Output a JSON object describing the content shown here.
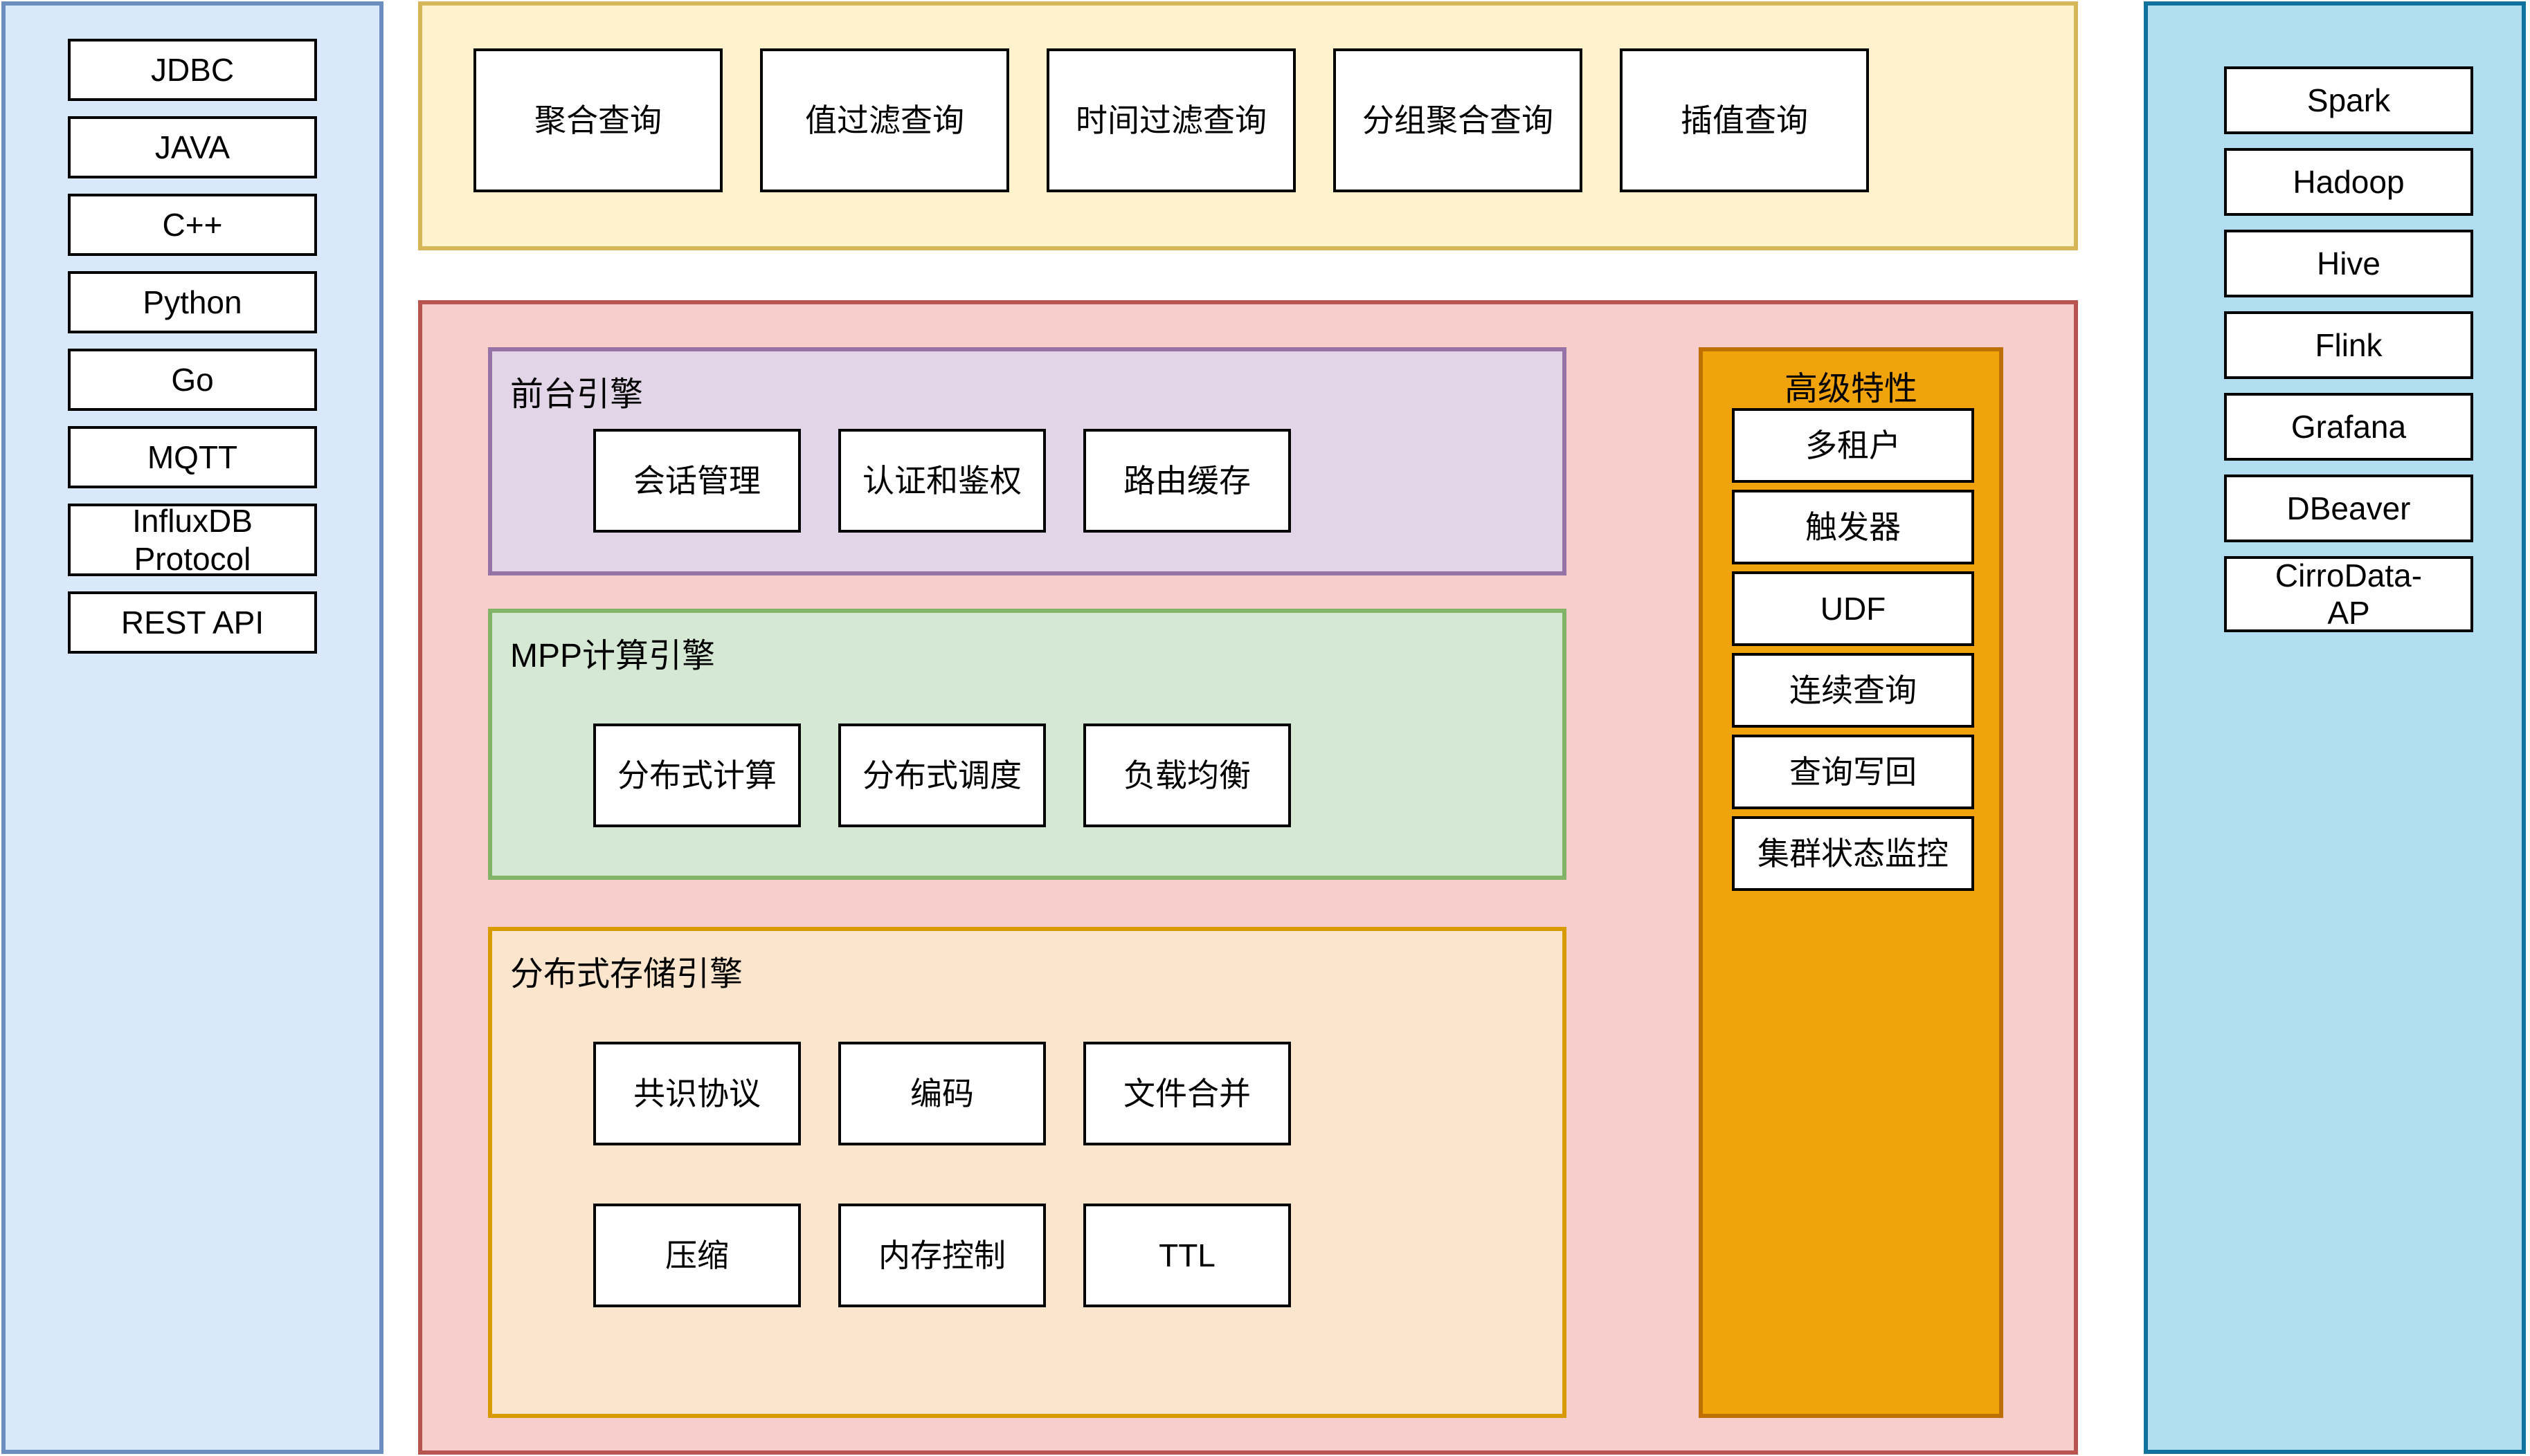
{
  "left_panel": {
    "name": "client-interfaces",
    "bg_color": "#dae8fc",
    "border_color": "#6c8ebf",
    "items": [
      {
        "label": "JDBC"
      },
      {
        "label": "JAVA"
      },
      {
        "label": "C++"
      },
      {
        "label": "Python"
      },
      {
        "label": "Go"
      },
      {
        "label": "MQTT"
      },
      {
        "label": "InfluxDB\nProtocol"
      },
      {
        "label": "REST API"
      }
    ]
  },
  "query_panel": {
    "name": "query-capabilities",
    "bg_color": "#fff2cc",
    "border_color": "#d6b656",
    "items": [
      {
        "label": "聚合查询"
      },
      {
        "label": "值过滤查询"
      },
      {
        "label": "时间过滤查询"
      },
      {
        "label": "分组聚合查询"
      },
      {
        "label": "插值查询"
      }
    ]
  },
  "engine_panel": {
    "name": "database-engine",
    "bg_color": "#f8cecc",
    "border_color": "#b85450",
    "frontend_engine": {
      "title": "前台引擎",
      "bg_color": "#e1d5e7",
      "border_color": "#9673a6",
      "items": [
        {
          "label": "会话管理"
        },
        {
          "label": "认证和鉴权"
        },
        {
          "label": "路由缓存"
        }
      ]
    },
    "mpp_engine": {
      "title": "MPP计算引擎",
      "bg_color": "#d5e8d4",
      "border_color": "#82b366",
      "items": [
        {
          "label": "分布式计算"
        },
        {
          "label": "分布式调度"
        },
        {
          "label": "负载均衡"
        }
      ]
    },
    "storage_engine": {
      "title": "分布式存储引擎",
      "bg_color": "#fce5cd",
      "border_color": "#d79b00",
      "row1": [
        {
          "label": "共识协议"
        },
        {
          "label": "编码"
        },
        {
          "label": "文件合并"
        }
      ],
      "row2": [
        {
          "label": "压缩"
        },
        {
          "label": "内存控制"
        },
        {
          "label": "TTL"
        }
      ]
    },
    "advanced_features": {
      "title": "高级特性",
      "bg_color": "#f0a30a",
      "border_color": "#bd7000",
      "items": [
        {
          "label": "多租户"
        },
        {
          "label": "触发器"
        },
        {
          "label": "UDF"
        },
        {
          "label": "连续查询"
        },
        {
          "label": "查询写回"
        },
        {
          "label": "集群状态监控"
        }
      ]
    }
  },
  "ecosystem_panel": {
    "name": "ecosystem-integrations",
    "bg_color": "#b1ddf0",
    "border_color": "#10739e",
    "items": [
      {
        "label": "Spark"
      },
      {
        "label": "Hadoop"
      },
      {
        "label": "Hive"
      },
      {
        "label": "Flink"
      },
      {
        "label": "Grafana"
      },
      {
        "label": "DBeaver"
      },
      {
        "label": "CirroData-\nAP"
      }
    ]
  }
}
